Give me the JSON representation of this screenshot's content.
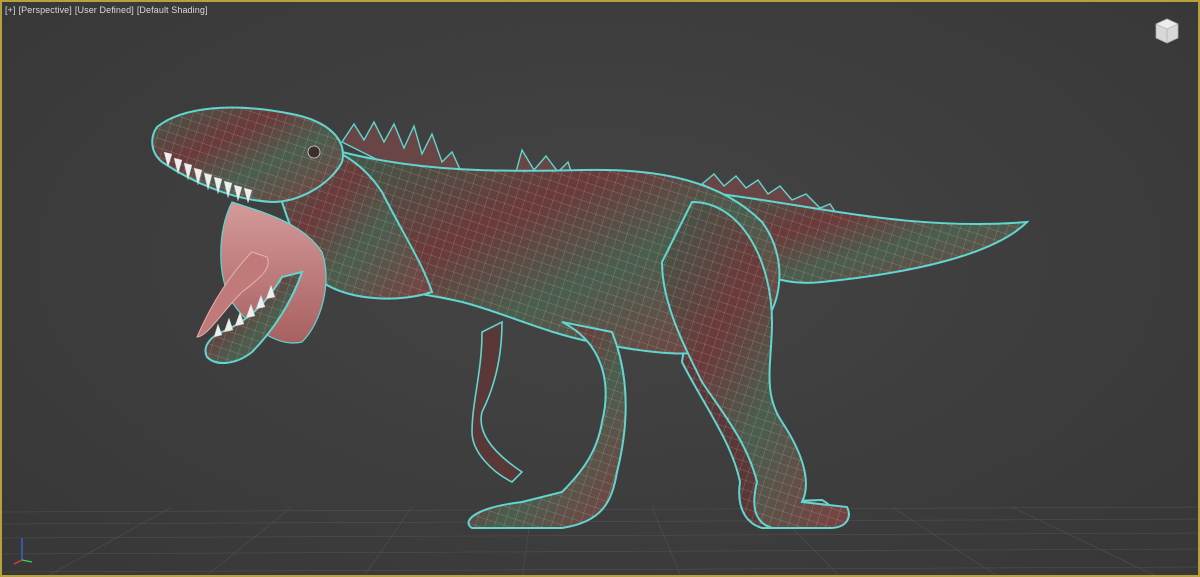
{
  "viewport": {
    "labels": [
      "[+]",
      "[Perspective]",
      "[User Defined]",
      "[Default Shading]"
    ],
    "border_color": "#b8a13a",
    "background_color": "#3d3d3d"
  },
  "viewcube": {
    "icon": "viewcube-icon"
  },
  "scene": {
    "object": "dinosaur-wireframe-model",
    "wire_color": "#5fd6d0",
    "skin_colors": [
      "#6b3a3a",
      "#3f5a4a",
      "#8a4a4a"
    ]
  },
  "axis_tripod": {
    "icon": "axis-tripod-icon"
  }
}
